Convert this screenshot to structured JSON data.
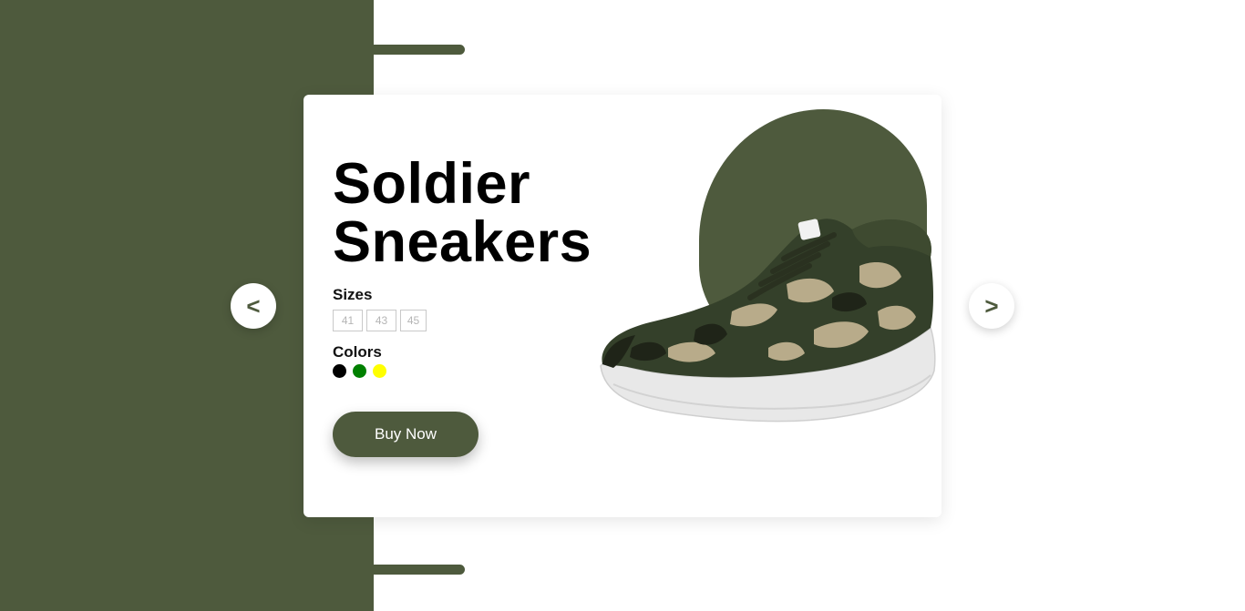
{
  "product": {
    "title_line1": "Soldier",
    "title_line2": "Sneakers",
    "image_alt": "camouflage sneaker"
  },
  "sizes": {
    "label": "Sizes",
    "options": [
      "41",
      "43",
      "45"
    ]
  },
  "colors": {
    "label": "Colors",
    "options": [
      "#000000",
      "#008000",
      "#ffff00"
    ]
  },
  "actions": {
    "buy_label": "Buy Now"
  },
  "navigation": {
    "prev_label": "<",
    "next_label": ">"
  },
  "theme": {
    "accent": "#4e5a3d",
    "camo_dark": "#2d3522",
    "camo_light": "#b8ab8a",
    "sole": "#e8e8e8"
  }
}
